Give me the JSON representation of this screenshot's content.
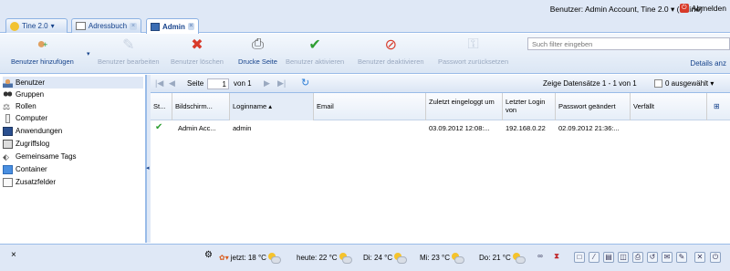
{
  "tabs": [
    {
      "label": "Tine 2.0",
      "icon": "tine-logo-icon",
      "suffix": "▾"
    },
    {
      "label": "Adressbuch",
      "icon": "addressbook-icon",
      "close": "×"
    },
    {
      "label": "Admin",
      "icon": "admin-icon",
      "close": "×"
    }
  ],
  "header": {
    "user_info": "Benutzer: Admin Account, Tine 2.0 ▾  (online)",
    "logout": "Abmelden"
  },
  "toolbar": {
    "add_user": "Benutzer hinzufügen",
    "edit_user": "Benutzer bearbeiten",
    "delete_user": "Benutzer löschen",
    "print_page": "Drucke Seite",
    "enable_user": "Benutzer aktivieren",
    "disable_user": "Benutzer deaktivieren",
    "reset_password": "Passwort zurücksetzen",
    "filter_placeholder": "Such filter eingeben",
    "details": "Details anz"
  },
  "sidebar": {
    "items": [
      {
        "label": "Benutzer",
        "icon": "user-icon"
      },
      {
        "label": "Gruppen",
        "icon": "group-icon"
      },
      {
        "label": "Rollen",
        "icon": "roles-icon"
      },
      {
        "label": "Computer",
        "icon": "computer-icon"
      },
      {
        "label": "Anwendungen",
        "icon": "applications-icon"
      },
      {
        "label": "Zugriffslog",
        "icon": "access-log-icon"
      },
      {
        "label": "Gemeinsame Tags",
        "icon": "tag-icon"
      },
      {
        "label": "Container",
        "icon": "container-icon"
      },
      {
        "label": "Zusatzfelder",
        "icon": "custom-fields-icon"
      }
    ]
  },
  "pager": {
    "page_label": "Seite",
    "page_value": "1",
    "of_label": "von 1",
    "summary": "Zeige Datensätze 1 - 1 von 1",
    "selected": "0 ausgewählt ▾"
  },
  "grid": {
    "columns": [
      "St...",
      "Bildschirm...",
      "Loginname",
      "Email",
      "Zuletzt eingeloggt um",
      "Letzter Login von",
      "Passwort geändert",
      "Verfällt"
    ],
    "rows": [
      {
        "status": "✔",
        "display_name": "Admin Acc...",
        "login": "admin",
        "email": "",
        "last_login": "03.09.2012 12:08:...",
        "last_login_from": "192.168.0.22",
        "password_changed": "02.09.2012 21:36:...",
        "expires": ""
      }
    ]
  },
  "footer": {
    "close": "×",
    "now": "jetzt: 18 °C",
    "today": "heute: 22 °C",
    "di": "Di: 24 °C",
    "mi": "Mi: 23 °C",
    "do": "Do: 21 °C"
  },
  "colors": {
    "accent": "#15428b",
    "panel": "#dfe8f6",
    "border": "#99bbe8",
    "ok_green": "#2e9e32",
    "delete_red": "#d83a2a"
  }
}
